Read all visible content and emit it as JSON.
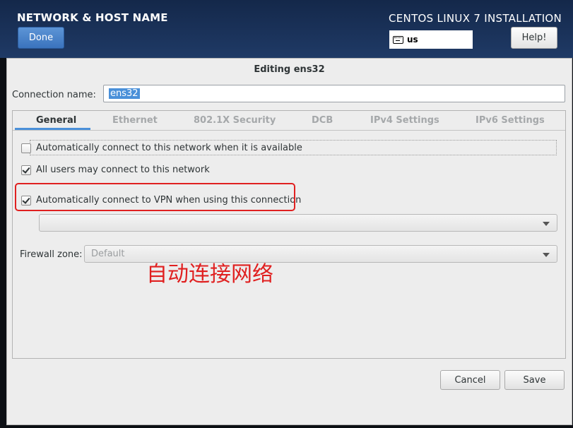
{
  "header": {
    "title": "NETWORK & HOST NAME",
    "done_label": "Done",
    "install_title": "CENTOS LINUX 7 INSTALLATION",
    "keyboard_layout": "us",
    "help_label": "Help!"
  },
  "dialog": {
    "title": "Editing ens32",
    "connection_name_label": "Connection name:",
    "connection_name_value": "ens32",
    "tabs": [
      {
        "label": "General",
        "active": true
      },
      {
        "label": "Ethernet",
        "active": false
      },
      {
        "label": "802.1X Security",
        "active": false
      },
      {
        "label": "DCB",
        "active": false
      },
      {
        "label": "IPv4 Settings",
        "active": false
      },
      {
        "label": "IPv6 Settings",
        "active": false
      }
    ],
    "general": {
      "auto_connect": {
        "label": "Automatically connect to this network when it is available",
        "checked": false
      },
      "all_users": {
        "label": "All users may connect to this network",
        "checked": true
      },
      "auto_vpn": {
        "label": "Automatically connect to VPN when using this connection",
        "checked": true
      },
      "vpn_select_value": "",
      "firewall_zone_label": "Firewall zone:",
      "firewall_zone_value": "Default"
    },
    "cancel_label": "Cancel",
    "save_label": "Save"
  },
  "annotation": {
    "text": "自动连接网络",
    "color": "#e02020"
  },
  "colors": {
    "header_bg": "#1f3a66",
    "accent": "#4a90d9",
    "highlight": "#e02020"
  }
}
